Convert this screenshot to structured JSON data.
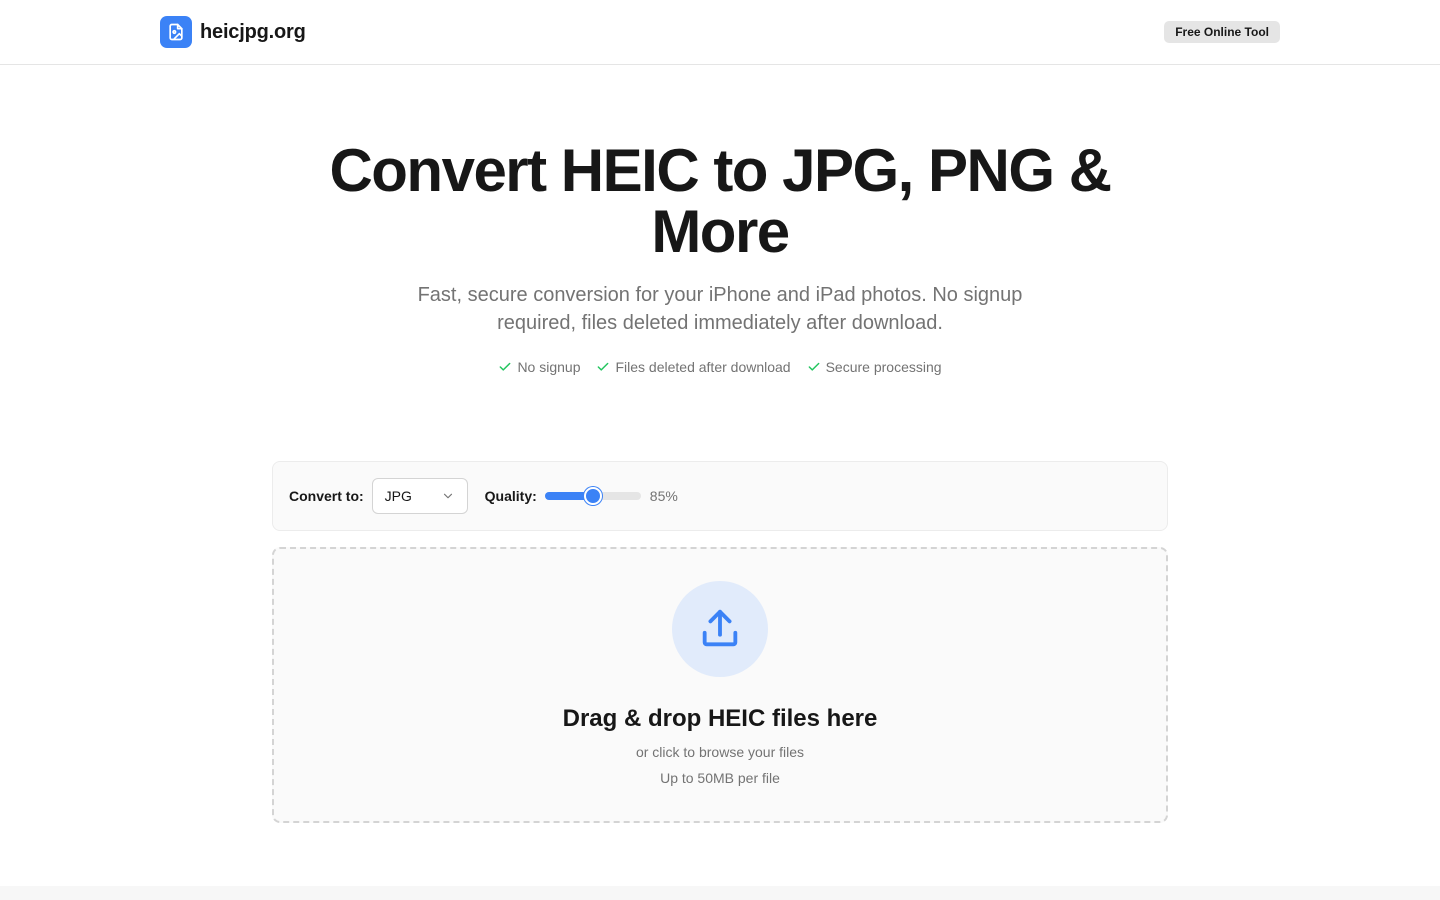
{
  "header": {
    "logo_icon": "image-file-icon",
    "site_name": "heicjpg.org",
    "badge": "Free Online Tool"
  },
  "hero": {
    "title": "Convert HEIC to JPG, PNG & More",
    "subtitle": "Fast, secure conversion for your iPhone and iPad photos. No signup required, files deleted immediately after download.",
    "features": [
      "No signup",
      "Files deleted after download",
      "Secure processing"
    ]
  },
  "controls": {
    "convert_label": "Convert to:",
    "format_selected": "JPG",
    "quality_label": "Quality:",
    "quality_value": 85,
    "quality_display": "85%"
  },
  "dropzone": {
    "icon": "upload-icon",
    "title": "Drag & drop HEIC files here",
    "subtitle": "or click to browse your files",
    "limit": "Up to 50MB per file"
  },
  "colors": {
    "accent": "#3b82f6",
    "check": "#22c55e",
    "text": "#171717",
    "muted": "#737373"
  }
}
